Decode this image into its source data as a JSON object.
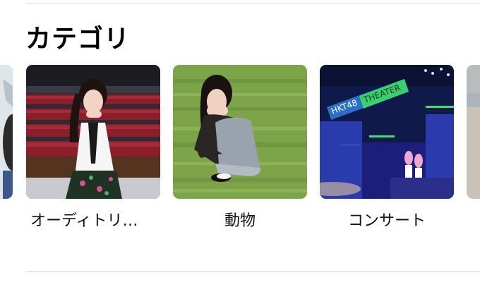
{
  "section": {
    "title": "カテゴリ"
  },
  "categories": [
    {
      "label": "オーディトリ…"
    },
    {
      "label": "動物"
    },
    {
      "label": "コンサート"
    }
  ],
  "colors": {
    "divider": "#d8d8d8",
    "text": "#111111"
  }
}
